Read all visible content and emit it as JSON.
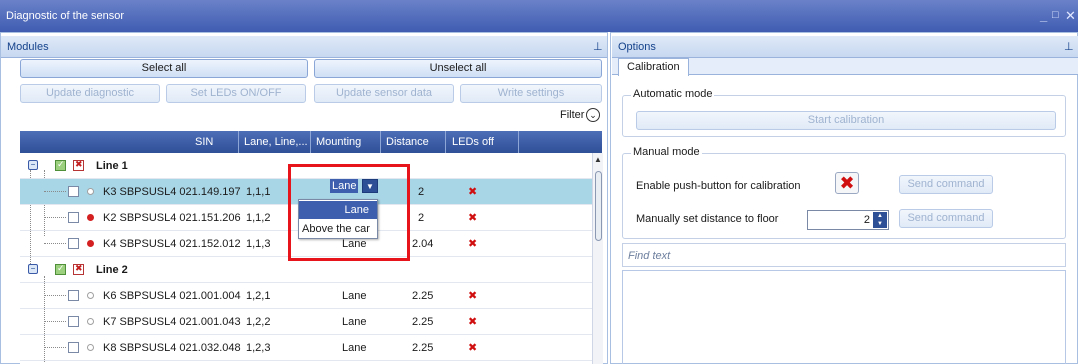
{
  "window": {
    "title": "Diagnostic of the sensor",
    "controls": [
      "_",
      "□",
      "✕"
    ]
  },
  "modules": {
    "title": "Modules",
    "select_all": "Select all",
    "unselect_all": "Unselect all",
    "update_diagnostic": "Update diagnostic",
    "set_leds": "Set LEDs ON/OFF",
    "update_sensor_data": "Update sensor data",
    "write_settings": "Write settings",
    "filter": "Filter",
    "columns": [
      "SIN",
      "Lane, Line,...",
      "Mounting",
      "Distance",
      "LEDs off"
    ],
    "groups": [
      {
        "label": "Line 1",
        "rows": [
          {
            "sin": "K3 SBPSUSL4 021.149.197",
            "lane": "1,1,1",
            "mounting": "Lane",
            "distance": "2",
            "status": "grey",
            "selected": true
          },
          {
            "sin": "K2 SBPSUSL4 021.151.206",
            "lane": "1,1,2",
            "mounting": "",
            "distance": "2",
            "status": "red",
            "selected": false
          },
          {
            "sin": "K4 SBPSUSL4 021.152.012",
            "lane": "1,1,3",
            "mounting": "Lane",
            "distance": "2.04",
            "status": "red",
            "selected": false
          }
        ]
      },
      {
        "label": "Line 2",
        "rows": [
          {
            "sin": "K6 SBPSUSL4 021.001.004",
            "lane": "1,2,1",
            "mounting": "Lane",
            "distance": "2.25",
            "status": "grey",
            "selected": false
          },
          {
            "sin": "K7 SBPSUSL4 021.001.043",
            "lane": "1,2,2",
            "mounting": "Lane",
            "distance": "2.25",
            "status": "grey",
            "selected": false
          },
          {
            "sin": "K8 SBPSUSL4 021.032.048",
            "lane": "1,2,3",
            "mounting": "Lane",
            "distance": "2.25",
            "status": "grey",
            "selected": false
          }
        ]
      }
    ],
    "mounting_dropdown": {
      "current": "Lane",
      "options": [
        "Lane",
        "Above the car"
      ],
      "highlighted": "Lane"
    }
  },
  "options": {
    "title": "Options",
    "tab": "Calibration",
    "automatic_mode": "Automatic mode",
    "start_calibration": "Start calibration",
    "manual_mode": "Manual mode",
    "enable_pushbutton_label": "Enable push-button for calibration",
    "manual_distance_label": "Manually set distance to floor",
    "manual_distance_value": "2",
    "send_command": "Send command",
    "find_placeholder": "Find text"
  },
  "colors": {
    "titlebar": "#4a66b8",
    "header_blue": "#2f4f97",
    "selected_row": "#a9d6e6",
    "highlight_box": "#e8141b",
    "error_red": "#d01010"
  },
  "icons": {
    "pin": "pin-icon",
    "filter": "chevron-down-circle-icon",
    "led_off": "red-x-icon",
    "expand": "tree-collapse-icon"
  }
}
